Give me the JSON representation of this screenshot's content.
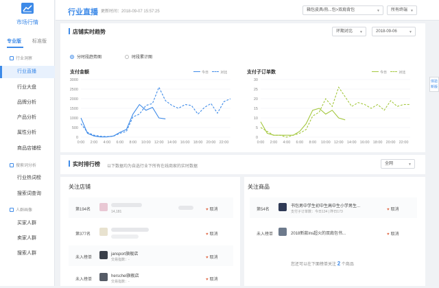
{
  "sidebar": {
    "app_title": "市场行情",
    "version_tabs": [
      "专业版",
      "标准版"
    ],
    "sections": [
      {
        "title": "行业洞察",
        "items": [
          "行业直播",
          "行业大盘",
          "品牌分析",
          "产品分析",
          "属性分析",
          "商品店铺榜"
        ]
      },
      {
        "title": "搜索词分析",
        "items": [
          "行业热词榜",
          "搜索词查询"
        ]
      },
      {
        "title": "人群画像",
        "items": [
          "买家人群",
          "卖家人群",
          "搜索人群"
        ]
      }
    ],
    "active_item": "行业直播"
  },
  "header": {
    "title": "行业直播",
    "update_time": "更新时间：2018-09-07 15:57:25",
    "category_select": "箱包皮具/热...包>双肩背包",
    "terminal_select": "所有终端"
  },
  "side_tab": [
    "体验",
    "新版"
  ],
  "trend": {
    "title": "店铺实时趋势",
    "compare_select": "环期对比",
    "date_select": "2018-09-06",
    "radios": [
      "分时段趋势图",
      "时段累计图"
    ],
    "selected_radio": 0
  },
  "chart_data": [
    {
      "type": "line",
      "title": "支付金额",
      "x": [
        "0:00",
        "1:00",
        "2:00",
        "3:00",
        "4:00",
        "5:00",
        "6:00",
        "7:00",
        "8:00",
        "9:00",
        "10:00",
        "11:00",
        "12:00",
        "13:00",
        "14:00",
        "15:00",
        "16:00",
        "17:00",
        "18:00",
        "19:00",
        "20:00",
        "21:00",
        "22:00",
        "23:00"
      ],
      "xticks": [
        "0:00",
        "2:00",
        "4:00",
        "6:00",
        "8:00",
        "10:00",
        "12:00",
        "14:00",
        "16:00",
        "18:00",
        "20:00",
        "22:00"
      ],
      "ylim": [
        0,
        3000
      ],
      "yticks": [
        0,
        500,
        1000,
        1500,
        2000,
        2500,
        3000
      ],
      "legend": [
        "今日",
        "对比"
      ],
      "series": [
        {
          "name": "今日",
          "color": "#3d8ae8",
          "style": "solid",
          "values": [
            1000,
            200,
            60,
            10,
            10,
            60,
            250,
            400,
            1200,
            1700,
            1400,
            1550,
            1000,
            950,
            null,
            null,
            null,
            null,
            null,
            null,
            null,
            null,
            null,
            null
          ]
        },
        {
          "name": "对比",
          "color": "#3d8ae8",
          "style": "dashed",
          "values": [
            700,
            250,
            100,
            50,
            30,
            50,
            200,
            300,
            1050,
            1200,
            1650,
            1750,
            2600,
            1900,
            1650,
            1500,
            1700,
            1650,
            1200,
            1550,
            1750,
            1250,
            1850,
            2000
          ]
        }
      ]
    },
    {
      "type": "line",
      "title": "支付子订单数",
      "x": [
        "0:00",
        "1:00",
        "2:00",
        "3:00",
        "4:00",
        "5:00",
        "6:00",
        "7:00",
        "8:00",
        "9:00",
        "10:00",
        "11:00",
        "12:00",
        "13:00",
        "14:00",
        "15:00",
        "16:00",
        "17:00",
        "18:00",
        "19:00",
        "20:00",
        "21:00",
        "22:00",
        "23:00"
      ],
      "xticks": [
        "0:00",
        "2:00",
        "4:00",
        "6:00",
        "8:00",
        "10:00",
        "12:00",
        "14:00",
        "16:00",
        "18:00",
        "20:00",
        "22:00"
      ],
      "ylim": [
        0,
        30
      ],
      "yticks": [
        0,
        5,
        10,
        15,
        20,
        25,
        30
      ],
      "legend": [
        "今日",
        "对比"
      ],
      "series": [
        {
          "name": "今日",
          "color": "#a3c73d",
          "style": "solid",
          "values": [
            8,
            2,
            1,
            1,
            1,
            1,
            3,
            7,
            14,
            15,
            12,
            14,
            10,
            9,
            null,
            null,
            null,
            null,
            null,
            null,
            null,
            null,
            null,
            null
          ]
        },
        {
          "name": "对比",
          "color": "#a3c73d",
          "style": "dashed",
          "values": [
            5,
            3,
            1,
            1,
            0,
            1,
            2,
            4,
            11,
            13,
            20,
            16,
            26,
            21,
            16,
            18,
            17,
            15,
            17,
            14,
            19,
            16,
            17,
            17
          ]
        }
      ]
    }
  ],
  "ranking": {
    "title": "实时排行榜",
    "description": "以下数据均为自选行业下所有在线商家的实时数据",
    "select": "全网"
  },
  "shops": {
    "title": "关注店铺",
    "rows": [
      {
        "rank": "第194名",
        "name": "",
        "sub": "",
        "number": "14,181",
        "cancel": "取消"
      },
      {
        "rank": "第377名",
        "name": "",
        "sub": "",
        "number": "",
        "cancel": "取消"
      },
      {
        "rank": "未入榜单",
        "name": "jansport旗舰店",
        "sub": "交易指数：-",
        "number": "",
        "cancel": "取消"
      },
      {
        "rank": "未入榜单",
        "name": "herschel旗舰店",
        "sub": "交易指数：-",
        "number": "",
        "cancel": "取消"
      }
    ]
  },
  "products": {
    "title": "关注商品",
    "rows": [
      {
        "rank": "第54名",
        "name": "书包男中学生初中生高中生小学男生...",
        "sub": "支付子订单数：今日134 | 昨日173",
        "cancel": "取消"
      },
      {
        "rank": "未入榜单",
        "name": "2018新款ins超火的双肩包书...",
        "sub": "",
        "cancel": "取消"
      }
    ],
    "footnote_prefix": "您还可以在下面榜单关注",
    "footnote_count": "2",
    "footnote_suffix": "个商品"
  },
  "colors": {
    "accent": "#3d8ae8",
    "orders_line": "#a3c73d",
    "heart": "#e2704f"
  }
}
